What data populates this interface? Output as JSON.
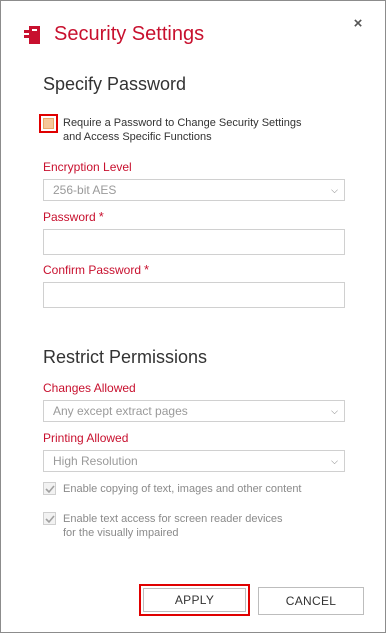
{
  "dialog": {
    "title": "Security Settings",
    "icons": {
      "app": "security-document-icon",
      "close": "close-icon"
    },
    "close_symbol": "×",
    "accent_color": "#c8102e"
  },
  "password_section": {
    "heading": "Specify Password",
    "require_password": {
      "label_line1": "Require a Password to Change Security Settings",
      "label_line2": "and Access Specific Functions",
      "checked": false
    },
    "encryption_level": {
      "label": "Encryption Level",
      "value": "256-bit AES"
    },
    "password": {
      "label": "Password",
      "required_mark": "*",
      "value": ""
    },
    "confirm_password": {
      "label": "Confirm Password",
      "required_mark": "*",
      "value": ""
    }
  },
  "permissions_section": {
    "heading": "Restrict Permissions",
    "changes_allowed": {
      "label": "Changes Allowed",
      "value": "Any except extract pages"
    },
    "printing_allowed": {
      "label": "Printing Allowed",
      "value": "High Resolution"
    },
    "enable_copying": {
      "label": "Enable copying of text, images and other content",
      "checked": true
    },
    "enable_text_access": {
      "label_line1": "Enable text access for screen reader devices",
      "label_line2": "for the visually impaired",
      "checked": true
    }
  },
  "buttons": {
    "apply": "APPLY",
    "cancel": "CANCEL"
  }
}
